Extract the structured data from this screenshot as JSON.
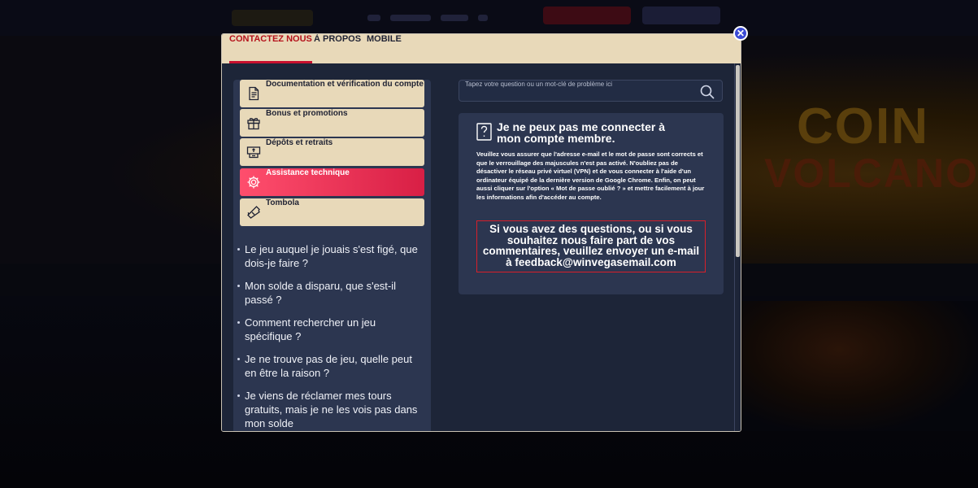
{
  "tabs": [
    {
      "label": "CONTACTEZ NOUS",
      "active": true
    },
    {
      "label": "À PROPOS",
      "active": false
    },
    {
      "label": "MOBILE",
      "active": false
    }
  ],
  "menu": [
    {
      "label": "Documentation et vérification du compte",
      "icon": "document-icon",
      "active": false
    },
    {
      "label": "Bonus et promotions",
      "icon": "gift-icon",
      "active": false
    },
    {
      "label": "Dépôts et retraits",
      "icon": "wallet-icon",
      "active": false
    },
    {
      "label": "Assistance technique",
      "icon": "gear-icon",
      "active": true
    },
    {
      "label": "Tombola",
      "icon": "ticket-icon",
      "active": false
    }
  ],
  "faq": [
    "Le jeu auquel je jouais s'est figé, que dois-je faire ?",
    "Mon solde a disparu, que s'est-il passé ?",
    "Comment rechercher un jeu spécifique ?",
    "Je ne trouve pas de jeu, quelle peut en être la raison ?",
    "Je viens de réclamer mes tours gratuits, mais je ne les vois pas dans mon solde"
  ],
  "search": {
    "placeholder": "Tapez votre question ou un mot-clé de problème ici"
  },
  "answer": {
    "title": "Je ne peux pas me connecter à mon compte membre.",
    "body": "Veuillez vous assurer que l'adresse e-mail et le mot de passe sont corrects et que le verrouillage des majuscules n'est pas activé. N'oubliez pas de désactiver le réseau privé virtuel (VPN) et de vous connecter à l'aide d'un ordinateur équipé de la dernière version de Google Chrome. Enfin, on peut aussi cliquer sur l'option « Mot de passe oublié ? » et mettre facilement à jour les informations afin d'accéder au compte.",
    "contact": "Si vous avez des questions, ou si vous souhaitez nous faire part de vos commentaires, veuillez envoyer un e-mail à feedback@winvegasemail.com"
  },
  "colors": {
    "accent": "#c8102e",
    "tab_bg": "#e8d9b9",
    "panel": "#2c3650",
    "modal_bg": "#1d2538"
  }
}
